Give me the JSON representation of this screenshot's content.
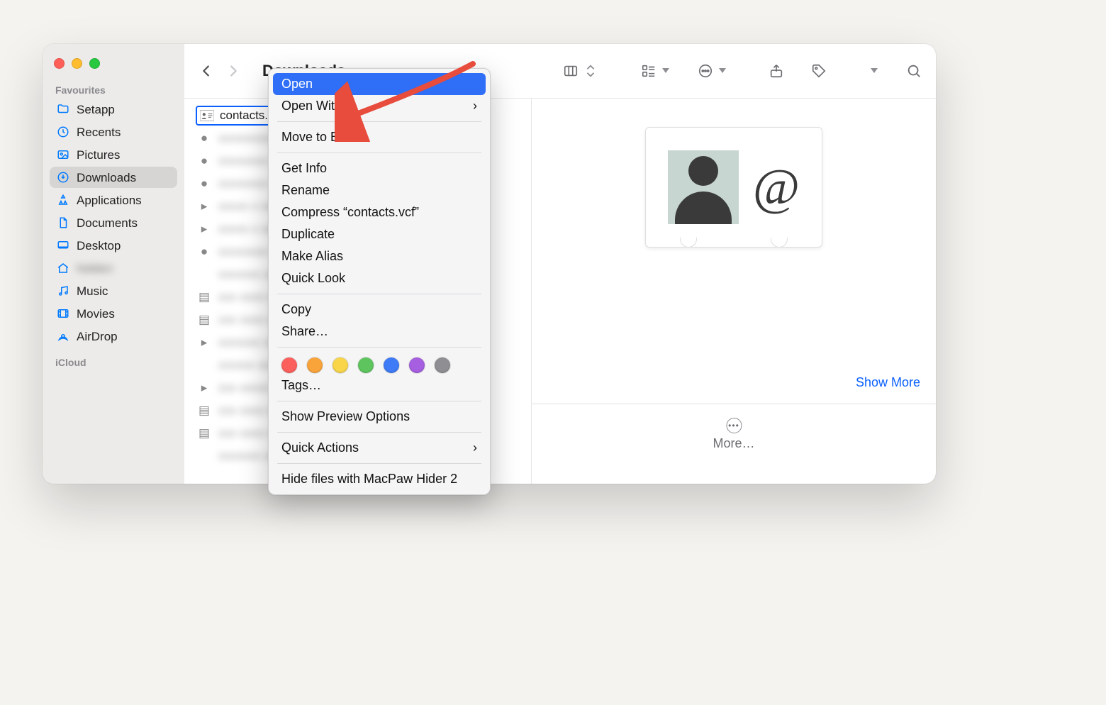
{
  "window": {
    "title": "Downloads"
  },
  "sidebar": {
    "section_favourites": "Favourites",
    "section_icloud": "iCloud",
    "items": [
      {
        "label": "Setapp",
        "icon": "folder-icon"
      },
      {
        "label": "Recents",
        "icon": "clock-icon"
      },
      {
        "label": "Pictures",
        "icon": "picture-icon"
      },
      {
        "label": "Downloads",
        "icon": "download-icon",
        "active": true
      },
      {
        "label": "Applications",
        "icon": "apps-icon"
      },
      {
        "label": "Documents",
        "icon": "document-icon"
      },
      {
        "label": "Desktop",
        "icon": "desktop-icon"
      },
      {
        "label": "hidden",
        "icon": "home-icon",
        "blur": true
      },
      {
        "label": "Music",
        "icon": "music-icon"
      },
      {
        "label": "Movies",
        "icon": "movie-icon"
      },
      {
        "label": "AirDrop",
        "icon": "airdrop-icon"
      }
    ]
  },
  "files": {
    "selected": {
      "name": "contacts.vcf"
    }
  },
  "context_menu": {
    "open": "Open",
    "open_with": "Open With",
    "move_to_bin": "Move to Bin",
    "get_info": "Get Info",
    "rename": "Rename",
    "compress": "Compress “contacts.vcf”",
    "duplicate": "Duplicate",
    "make_alias": "Make Alias",
    "quick_look": "Quick Look",
    "copy": "Copy",
    "share": "Share…",
    "tags": "Tags…",
    "show_preview_options": "Show Preview Options",
    "quick_actions": "Quick Actions",
    "hide_files": "Hide files with MacPaw Hider 2",
    "tag_colors": [
      "#fc605c",
      "#f9a43b",
      "#f8d549",
      "#5ec55e",
      "#3f7bf6",
      "#a65fe0",
      "#8e8e93"
    ]
  },
  "preview": {
    "show_more": "Show More",
    "more": "More…"
  }
}
